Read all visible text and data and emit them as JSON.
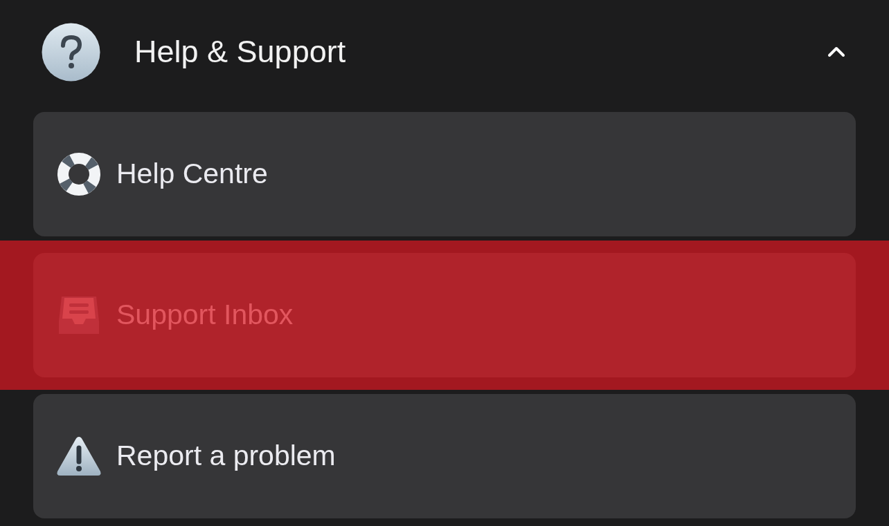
{
  "header": {
    "title": "Help & Support",
    "expanded": true
  },
  "items": [
    {
      "kind": "lifebuoy",
      "label": "Help Centre",
      "highlighted": false
    },
    {
      "kind": "inbox",
      "label": "Support Inbox",
      "highlighted": true
    },
    {
      "kind": "warning",
      "label": "Report a problem",
      "highlighted": false
    }
  ]
}
